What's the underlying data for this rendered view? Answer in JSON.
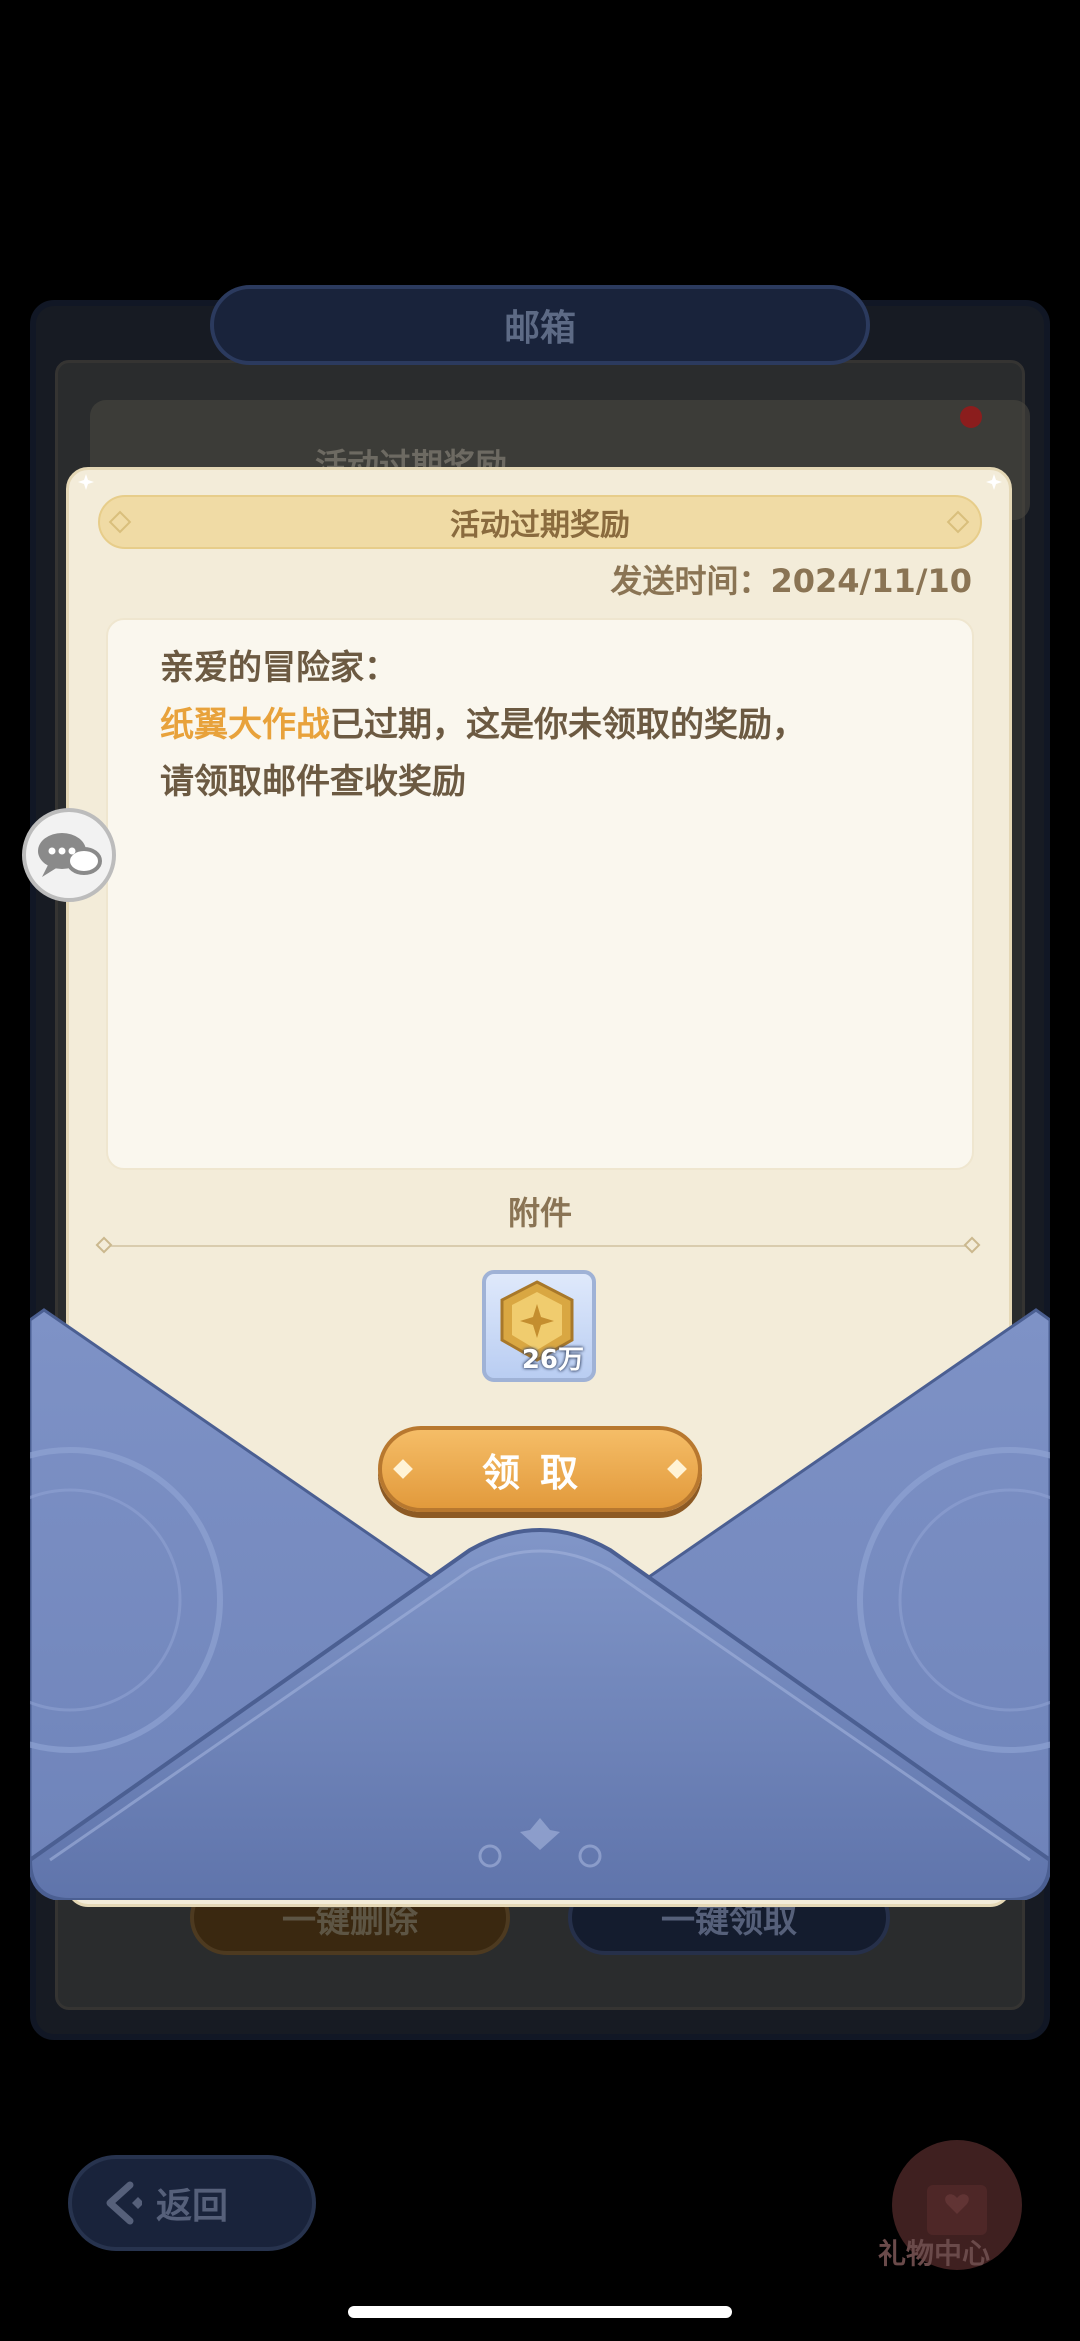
{
  "mailbox": {
    "title": "邮箱",
    "list_item_title": "活动过期奖励",
    "delete_all_label": "一键删除",
    "claim_all_label": "一键领取"
  },
  "nav": {
    "back_label": "返回",
    "gift_center_label": "礼物中心"
  },
  "mail": {
    "title": "活动过期奖励",
    "sent_time": "发送时间：2024/11/10",
    "greeting": "亲爱的冒险家：",
    "event_name": "纸翼大作战",
    "body_line1_rest": "已过期，这是你未领取的奖励，",
    "body_line2": "请领取邮件查收奖励",
    "attachment_label": "附件",
    "attachments": [
      {
        "icon": "gold-coin-icon",
        "quantity": "26万"
      }
    ],
    "claim_label": "领取"
  },
  "colors": {
    "card_bg": "#f3ecd9",
    "highlight": "#e8a23b",
    "envelope": "#7a90c4",
    "claim_button": "#e8a23b"
  }
}
